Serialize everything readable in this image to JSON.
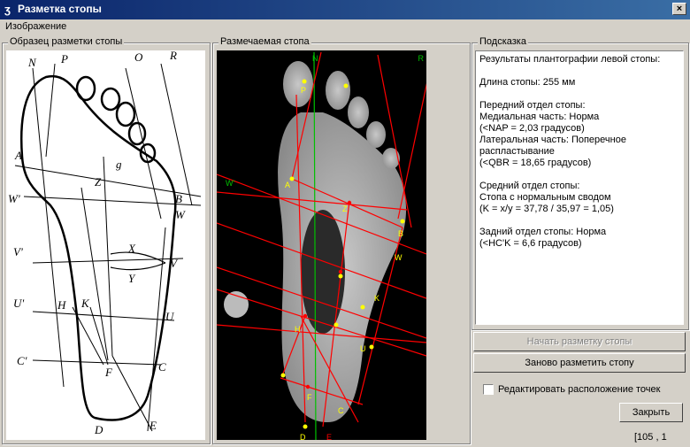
{
  "window": {
    "title": "Разметка стопы",
    "close_glyph": "×"
  },
  "menu": {
    "items": [
      "Изображение"
    ]
  },
  "panels": {
    "sample": {
      "label": "Образец разметки стопы"
    },
    "marked": {
      "label": "Размечаемая стопа"
    },
    "hint": {
      "label": "Подсказка"
    }
  },
  "sample_labels": [
    "N",
    "P",
    "O",
    "R",
    "A",
    "Z",
    "g",
    "W'",
    "B",
    "W",
    "V'",
    "X",
    "Y",
    "V",
    "U'",
    "H",
    "K",
    "U",
    "C'",
    "F",
    "C",
    "D",
    "E"
  ],
  "foot_labels": [
    "N",
    "P",
    "R",
    "W'",
    "A",
    "Z",
    "B",
    "W",
    "K",
    "U",
    "H",
    "C",
    "D",
    "F",
    "E"
  ],
  "hint_lines": [
    "Результаты плантографии левой стопы:",
    "",
    "Длина стопы: 255 мм",
    "",
    "Передний отдел стопы:",
    "Медиальная часть: Норма",
    "(<NAP = 2,03 градусов)",
    "Латеральная часть: Поперечное",
    "распластывание",
    "(<QBR = 18,65 градусов)",
    "",
    "Средний отдел стопы:",
    "Стопа с нормальным сводом",
    "(K = x/y = 37,78 / 35,97 = 1,05)",
    "",
    "Задний отдел стопы: Норма",
    "(<HC'K = 6,6 градусов)"
  ],
  "buttons": {
    "start": "Начать разметку стопы",
    "again": "Заново разметить стопу",
    "close": "Закрыть"
  },
  "checkbox": {
    "label": "Редактировать расположение точек",
    "checked": false
  },
  "status": {
    "coords": "[105 , 1"
  },
  "colors": {
    "mark_line": "#ff0000",
    "axis_line": "#00c000",
    "point": "#ffff00"
  }
}
